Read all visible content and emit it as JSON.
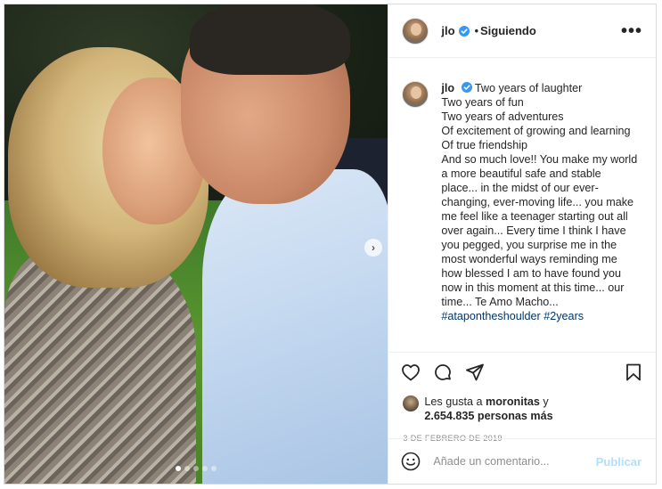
{
  "post": {
    "username": "jlo",
    "follow_separator": "•",
    "follow_status": "Siguiendo",
    "more_glyph": "•••",
    "caption": {
      "first_line": "Two years of laughter",
      "lines": [
        "Two years of fun",
        "Two years of adventures",
        "Of excitement of growing and learning",
        "Of true friendship",
        "And so much love!! You make my world a more beautiful safe and stable place... in the midst of our ever-changing, ever-moving life... you make me feel like a teenager starting out all over again... Every time I think I have you pegged, you surprise me in the most wonderful ways reminding me how blessed I am to have found you now in this moment at this time... our time... Te Amo Macho..."
      ],
      "hashtags": [
        "#atapontheshoulder",
        "#2years"
      ]
    },
    "likes": {
      "prefix": "Les gusta a ",
      "user": "moronitas",
      "connector": " y",
      "count_text": "2.654.835 personas más"
    },
    "date": "3 DE FEBRERO DE 2019",
    "comment": {
      "placeholder": "Añade un comentario...",
      "publish_label": "Publicar"
    },
    "carousel": {
      "total": 5,
      "active_index": 0,
      "next_glyph": "›"
    },
    "icons": {
      "verified": "verified-badge-icon",
      "like": "heart-icon",
      "comment": "comment-bubble-icon",
      "share": "paper-plane-icon",
      "save": "bookmark-icon",
      "emoji": "smiley-icon",
      "more": "more-options-icon"
    },
    "colors": {
      "verified_blue": "#3897f0",
      "hashtag": "#00376b",
      "publish_disabled": "#b2dffc",
      "meta_gray": "#8e8e8e"
    }
  }
}
